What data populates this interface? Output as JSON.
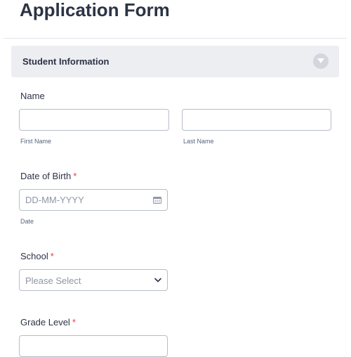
{
  "page": {
    "title": "Application Form"
  },
  "section": {
    "title": "Student Information"
  },
  "name_field": {
    "label": "Name",
    "first_sublabel": "First Name",
    "last_sublabel": "Last Name",
    "first_value": "",
    "last_value": ""
  },
  "dob_field": {
    "label": "Date of Birth",
    "required_mark": "*",
    "placeholder": "DD-MM-YYYY",
    "sublabel": "Date",
    "icon": "calendar-icon"
  },
  "school_field": {
    "label": "School",
    "required_mark": "*",
    "selected": "Please Select",
    "icon": "chevron-down-icon"
  },
  "grade_field": {
    "label": "Grade Level",
    "required_mark": "*"
  },
  "colors": {
    "required": "#e53e3e",
    "section_bg": "#eceef2",
    "text": "#2c3345"
  }
}
